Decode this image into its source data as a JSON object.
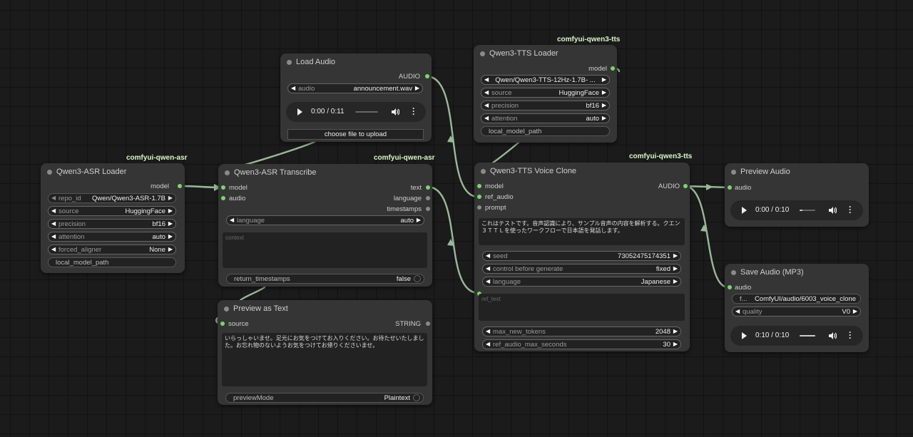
{
  "tags": {
    "asr_loader": "comfyui-qwen-asr",
    "asr_transcribe": "comfyui-qwen-asr",
    "tts_loader": "comfyui-qwen3-tts",
    "voice_clone": "comfyui-qwen3-tts"
  },
  "asr_loader": {
    "title": "Qwen3-ASR Loader",
    "out_model": "model",
    "repo_id": {
      "label": "repo_id",
      "value": "Qwen/Qwen3-ASR-1.7B"
    },
    "source": {
      "label": "source",
      "value": "HuggingFace"
    },
    "precision": {
      "label": "precision",
      "value": "bf16"
    },
    "attention": {
      "label": "attention",
      "value": "auto"
    },
    "forced_aligner": {
      "label": "forced_aligner",
      "value": "None"
    },
    "local_model_path": "local_model_path"
  },
  "load_audio": {
    "title": "Load Audio",
    "out_audio": "AUDIO",
    "audio": {
      "label": "audio",
      "value": "announcement.wav"
    },
    "player_time": "0:00 / 0:11",
    "player_progress": 0,
    "upload_label": "choose file to upload"
  },
  "asr_transcribe": {
    "title": "Qwen3-ASR Transcribe",
    "in_model": "model",
    "in_audio": "audio",
    "out_text": "text",
    "out_language": "language",
    "out_timestamps": "timestamps",
    "language": {
      "label": "language",
      "value": "auto"
    },
    "context_placeholder": "context",
    "return_timestamps": {
      "label": "return_timestamps",
      "value": "false"
    }
  },
  "preview_text": {
    "title": "Preview as Text",
    "in_source": "source",
    "out_string": "STRING",
    "text": "いらっしゃいませ。足元にお気をつけてお入りください。お待たせいたしました。お忘れ物のないようお気をつけてお帰りくださいませ。",
    "preview_mode": {
      "label": "previewMode",
      "value": "Plaintext"
    }
  },
  "tts_loader": {
    "title": "Qwen3-TTS Loader",
    "out_model": "model",
    "repo": "Qwen/Qwen3-TTS-12Hz-1.7B- ...",
    "source": {
      "label": "source",
      "value": "HuggingFace"
    },
    "precision": {
      "label": "precision",
      "value": "bf16"
    },
    "attention": {
      "label": "attention",
      "value": "auto"
    },
    "local_model_path": "local_model_path"
  },
  "voice_clone": {
    "title": "Qwen3-TTS Voice Clone",
    "in_model": "model",
    "in_ref_audio": "ref_audio",
    "in_prompt": "prompt",
    "out_audio": "AUDIO",
    "text": "これはテストです。音声認識により、サンプル音声の内容を解析する。クエン３ＴＴＬを使ったワークフローで日本語を発話します。",
    "seed": {
      "label": "seed",
      "value": "73052475174351"
    },
    "control": {
      "label": "control before generate",
      "value": "fixed"
    },
    "language": {
      "label": "language",
      "value": "Japanese"
    },
    "ref_text_placeholder": "ref_text",
    "max_new_tokens": {
      "label": "max_new_tokens",
      "value": "2048"
    },
    "ref_audio_max_seconds": {
      "label": "ref_audio_max_seconds",
      "value": "30"
    }
  },
  "preview_audio": {
    "title": "Preview Audio",
    "in_audio": "audio",
    "player_time": "0:00 / 0:10",
    "player_progress": 0.2
  },
  "save_audio": {
    "title": "Save Audio (MP3)",
    "in_audio": "audio",
    "filename_prefix_label": "f...",
    "filename_prefix": "ComfyUI/audio/6003_voice_clone",
    "quality": {
      "label": "quality",
      "value": "V0"
    },
    "player_time": "0:10 / 0:10",
    "player_progress": 1.0
  },
  "colors": {
    "pin": "#7ad56d",
    "wire": "#9ab89a",
    "tag": "#d9f5c8"
  }
}
